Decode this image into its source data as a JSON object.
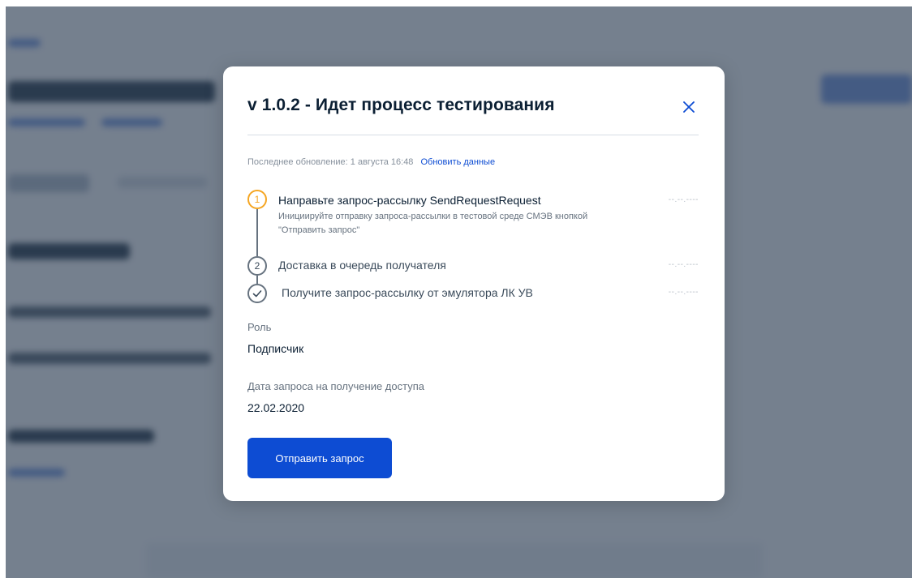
{
  "modal": {
    "title": "v 1.0.2 - Идет процесс тестирования",
    "close_icon": "close-icon",
    "last_update_label": "Последнее обновление: 1 августа 16:48",
    "refresh_link": "Обновить данные",
    "steps": [
      {
        "number": "1",
        "status": "active",
        "title": "Направьте запрос-рассылку SendRequestRequest",
        "description": "Инициируйте отправку запроса-рассылки в тестовой среде СМЭВ кнопкой \"Отправить запрос\"",
        "date": "--.--.----"
      },
      {
        "number": "2",
        "status": "pending",
        "title": "Доставка в очередь получателя",
        "date": "--.--.----"
      },
      {
        "number": "✓",
        "status": "pending",
        "icon": "check-icon",
        "title": "Получите запрос-рассылку от эмулятора ЛК УВ",
        "date": "--.--.----"
      }
    ],
    "role_label": "Роль",
    "role_value": "Подписчик",
    "date_label": "Дата запроса на получение доступа",
    "date_value": "22.02.2020",
    "send_button": "Отправить запрос"
  },
  "colors": {
    "accent": "#0d4cd3",
    "active_step": "#f5a623",
    "overlay": "#3a485c",
    "title": "#0b1f33"
  }
}
